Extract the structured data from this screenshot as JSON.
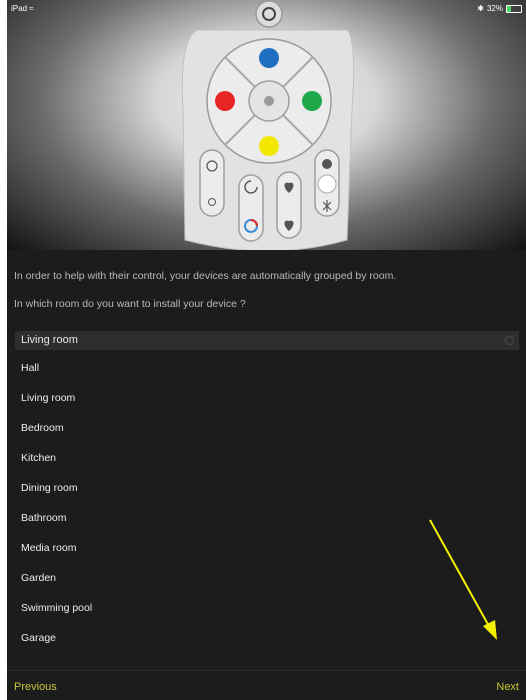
{
  "status_bar": {
    "device": "iPad",
    "wifi_icon": "wifi-icon",
    "bluetooth_icon": "bluetooth-icon",
    "battery_percent": "32%",
    "battery_level": 0.32,
    "battery_color": "#4cd964"
  },
  "hero_image": {
    "button_colors": [
      "#1f6fc0",
      "#e82525",
      "#1fa84a",
      "#f2e800",
      "#ffffff"
    ]
  },
  "intro_text": "In order to help with their control, your devices are automatically grouped by room.",
  "question_text": "In which room do you want to install your device ?",
  "room_select": {
    "selected": "Living room",
    "options": [
      "Hall",
      "Living room",
      "Bedroom",
      "Kitchen",
      "Dining room",
      "Bathroom",
      "Media room",
      "Garden",
      "Swimming pool",
      "Garage"
    ]
  },
  "footer": {
    "previous_label": "Previous",
    "next_label": "Next",
    "accent_color": "#c8c83a"
  },
  "annotation_arrow_color": "#f5f000"
}
